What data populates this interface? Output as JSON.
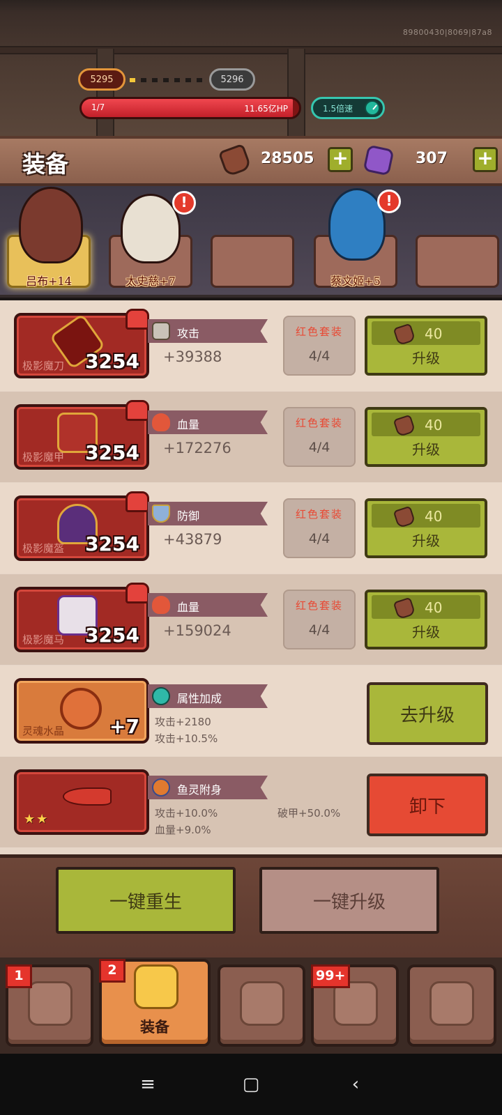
{
  "build_id": "89800430|8069|87a8",
  "battle": {
    "current_level": "5295",
    "next_level": "5296",
    "track_progress": 0.15,
    "wave": "1/7",
    "hp_text": "11.65亿HP",
    "hp_fraction": 0.97,
    "speed": "1.5倍速"
  },
  "header": {
    "title": "装备",
    "wood_amount": "28505",
    "gem_amount": "307",
    "plus": "+"
  },
  "heroes": [
    {
      "name": "吕布+14",
      "active": true
    },
    {
      "name": "太史慈+7",
      "active": false,
      "alert": "!"
    },
    {
      "name": "",
      "active": false
    },
    {
      "name": "蔡文姬+5",
      "active": false,
      "alert": "!"
    },
    {
      "name": "",
      "active": false
    }
  ],
  "equipment": [
    {
      "name": "极影魔刀",
      "level": "3254",
      "stat_label": "攻击",
      "stat_value": "+39388",
      "set_name": "红色套装",
      "set_count": "4/4",
      "cost": "40",
      "button": "升级"
    },
    {
      "name": "极影魔甲",
      "level": "3254",
      "stat_label": "血量",
      "stat_value": "+172276",
      "set_name": "红色套装",
      "set_count": "4/4",
      "cost": "40",
      "button": "升级"
    },
    {
      "name": "极影魔盔",
      "level": "3254",
      "stat_label": "防御",
      "stat_value": "+43879",
      "set_name": "红色套装",
      "set_count": "4/4",
      "cost": "40",
      "button": "升级"
    },
    {
      "name": "极影魔马",
      "level": "3254",
      "stat_label": "血量",
      "stat_value": "+159024",
      "set_name": "红色套装",
      "set_count": "4/4",
      "cost": "40",
      "button": "升级"
    }
  ],
  "crystal": {
    "name": "灵魂水晶",
    "level": "+7",
    "stat_label": "属性加成",
    "line1": "攻击+2180",
    "line2": "攻击+10.5%",
    "button": "去升级"
  },
  "fish": {
    "stars": "★★",
    "stat_label": "鱼灵附身",
    "line1": "攻击+10.0%",
    "line2": "血量+9.0%",
    "line3": "破甲+50.0%",
    "button": "卸下"
  },
  "actions": {
    "rebirth": "一键重生",
    "upgrade_all": "一键升级"
  },
  "tabs": [
    {
      "label": "",
      "badge": "1",
      "active": false
    },
    {
      "label": "装备",
      "badge": "2",
      "active": true
    },
    {
      "label": "",
      "badge": "",
      "active": false
    },
    {
      "label": "",
      "badge": "99+",
      "active": false
    },
    {
      "label": "",
      "badge": "",
      "active": false
    }
  ],
  "nav": {
    "menu": "≡",
    "home": "▢",
    "back": "‹"
  },
  "colors": {
    "upgrade_green": "#a9b73a",
    "unequip_red": "#e64a34",
    "set_red_text": "#e84934",
    "badge_red": "#e5342c"
  }
}
